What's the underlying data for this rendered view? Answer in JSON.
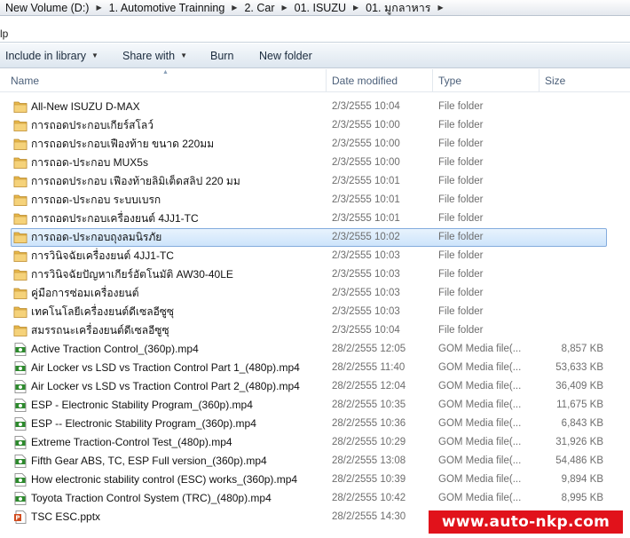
{
  "address": {
    "crumbs": [
      "New Volume (D:)",
      "1. Automotive Trainning",
      "2. Car",
      "01. ISUZU",
      "01. มูกลาหาร"
    ]
  },
  "search": {
    "text": "lp"
  },
  "toolbar": {
    "include_label": "Include in library",
    "share_label": "Share with",
    "burn_label": "Burn",
    "new_folder_label": "New folder"
  },
  "columns": {
    "name": "Name",
    "date": "Date modified",
    "type": "Type",
    "size": "Size"
  },
  "files": [
    {
      "name": "All-New ISUZU D-MAX",
      "date": "2/3/2555 10:04",
      "type": "File folder",
      "size": "",
      "icon": "folder-icon"
    },
    {
      "name": "การถอดประกอบเกียร์สโลว์",
      "date": "2/3/2555 10:00",
      "type": "File folder",
      "size": "",
      "icon": "folder-icon"
    },
    {
      "name": "การถอดประกอบเฟืองท้าย ขนาด 220มม",
      "date": "2/3/2555 10:00",
      "type": "File folder",
      "size": "",
      "icon": "folder-icon"
    },
    {
      "name": "การถอด-ประกอบ MUX5s",
      "date": "2/3/2555 10:00",
      "type": "File folder",
      "size": "",
      "icon": "folder-icon"
    },
    {
      "name": "การถอดประกอบ เฟืองท้ายลิมิเต็ดสลิป 220 มม",
      "date": "2/3/2555 10:01",
      "type": "File folder",
      "size": "",
      "icon": "folder-icon"
    },
    {
      "name": "การถอด-ประกอบ ระบบเบรก",
      "date": "2/3/2555 10:01",
      "type": "File folder",
      "size": "",
      "icon": "folder-icon"
    },
    {
      "name": "การถอดประกอบเครื่องยนต์ 4JJ1-TC",
      "date": "2/3/2555 10:01",
      "type": "File folder",
      "size": "",
      "icon": "folder-icon"
    },
    {
      "name": "การถอด-ประกอบถุงลมนิรภัย",
      "date": "2/3/2555 10:02",
      "type": "File folder",
      "size": "",
      "icon": "folder-icon",
      "selected": true
    },
    {
      "name": "การวินิจฉัยเครื่องยนต์ 4JJ1-TC",
      "date": "2/3/2555 10:03",
      "type": "File folder",
      "size": "",
      "icon": "folder-icon"
    },
    {
      "name": "การวินิจฉัยปัญหาเกียร์อัตโนมัติ AW30-40LE",
      "date": "2/3/2555 10:03",
      "type": "File folder",
      "size": "",
      "icon": "folder-icon"
    },
    {
      "name": "คู่มือการซ่อมเครื่องยนต์",
      "date": "2/3/2555 10:03",
      "type": "File folder",
      "size": "",
      "icon": "folder-icon"
    },
    {
      "name": "เทคโนโลยีเครื่องยนต์ดีเซลอีซูซุ",
      "date": "2/3/2555 10:03",
      "type": "File folder",
      "size": "",
      "icon": "folder-icon"
    },
    {
      "name": "สมรรถนะเครื่องยนต์ดีเซลอีซูซุ",
      "date": "2/3/2555 10:04",
      "type": "File folder",
      "size": "",
      "icon": "folder-icon"
    },
    {
      "name": "Active Traction Control_(360p).mp4",
      "date": "28/2/2555 12:05",
      "type": "GOM Media file(...",
      "size": "8,857 KB",
      "icon": "media-file-icon"
    },
    {
      "name": "Air Locker vs LSD vs Traction Control Part 1_(480p).mp4",
      "date": "28/2/2555 11:40",
      "type": "GOM Media file(...",
      "size": "53,633 KB",
      "icon": "media-file-icon"
    },
    {
      "name": "Air Locker vs LSD vs Traction Control Part 2_(480p).mp4",
      "date": "28/2/2555 12:04",
      "type": "GOM Media file(...",
      "size": "36,409 KB",
      "icon": "media-file-icon"
    },
    {
      "name": "ESP - Electronic Stability Program_(360p).mp4",
      "date": "28/2/2555 10:35",
      "type": "GOM Media file(...",
      "size": "11,675 KB",
      "icon": "media-file-icon"
    },
    {
      "name": "ESP -- Electronic Stability Program_(360p).mp4",
      "date": "28/2/2555 10:36",
      "type": "GOM Media file(...",
      "size": "6,843 KB",
      "icon": "media-file-icon"
    },
    {
      "name": "Extreme Traction-Control Test_(480p).mp4",
      "date": "28/2/2555 10:29",
      "type": "GOM Media file(...",
      "size": "31,926 KB",
      "icon": "media-file-icon"
    },
    {
      "name": "Fifth Gear ABS, TC, ESP Full version_(360p).mp4",
      "date": "28/2/2555 13:08",
      "type": "GOM Media file(...",
      "size": "54,486 KB",
      "icon": "media-file-icon"
    },
    {
      "name": "How electronic stability control (ESC) works_(360p).mp4",
      "date": "28/2/2555 10:39",
      "type": "GOM Media file(...",
      "size": "9,894 KB",
      "icon": "media-file-icon"
    },
    {
      "name": "Toyota Traction Control System (TRC)_(480p).mp4",
      "date": "28/2/2555 10:42",
      "type": "GOM Media file(...",
      "size": "8,995 KB",
      "icon": "media-file-icon"
    },
    {
      "name": "TSC ESC.pptx",
      "date": "28/2/2555 14:30",
      "type": "",
      "size": "",
      "icon": "powerpoint-file-icon"
    }
  ],
  "watermark": {
    "text": "www.auto-nkp.com"
  },
  "colors": {
    "selection": "#cde4fb",
    "selection_border": "#84acdd",
    "folder": "#e8b84a",
    "watermark_bg": "#e1121b"
  }
}
